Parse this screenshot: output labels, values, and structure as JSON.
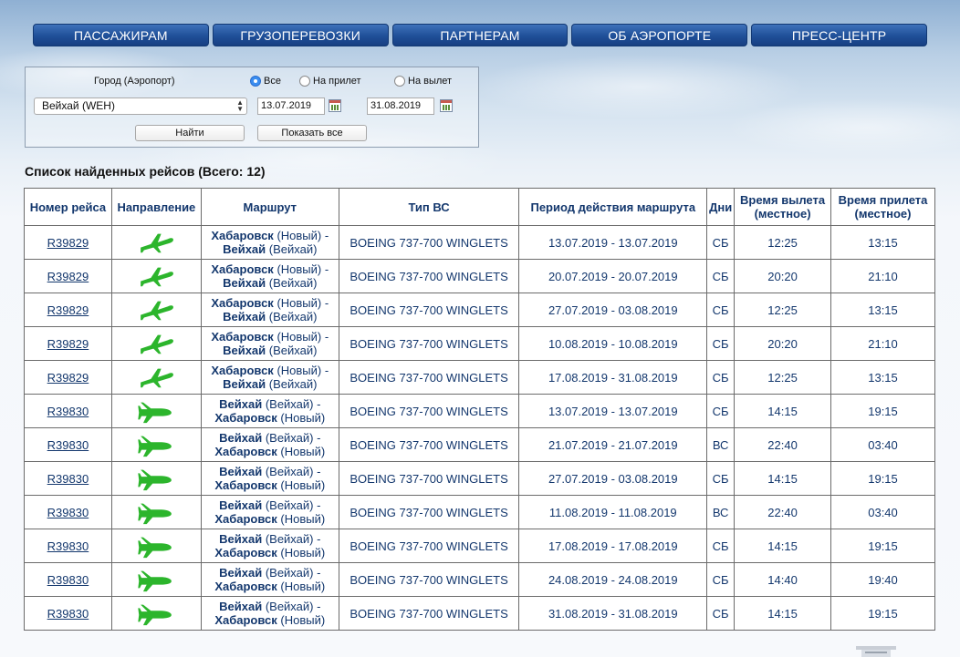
{
  "nav": [
    "ПАССАЖИРАМ",
    "ГРУЗОПЕРЕВОЗКИ",
    "ПАРТНЕРАМ",
    "ОБ АЭРОПОРТЕ",
    "ПРЕСС-ЦЕНТР"
  ],
  "search": {
    "city_label": "Город (Аэропорт)",
    "radio_all": "Все",
    "radio_arrival": "На прилет",
    "radio_departure": "На вылет",
    "selected_radio": "Все",
    "city_value": "Вейхай (WEH)",
    "date_from": "13.07.2019",
    "date_to": "31.08.2019",
    "find_button": "Найти",
    "show_all_button": "Показать все"
  },
  "results_title": "Список найденных рейсов (Всего: 12)",
  "table": {
    "headers": [
      "Номер рейса",
      "Направление",
      "Маршрут",
      "Тип ВС",
      "Период действия маршрута",
      "Дни",
      "Время вылета (местное)",
      "Время прилета (местное)"
    ],
    "rows": [
      {
        "flight": "R39829",
        "direction": "departure-plane-icon",
        "from_city": "Хабаровск",
        "from_airport": "(Новый) -",
        "to_city": "Вейхай",
        "to_airport": "(Вейхай)",
        "aircraft": "BOEING 737-700 WINGLETS",
        "period": "13.07.2019 - 13.07.2019",
        "days": "СБ",
        "dep": "12:25",
        "arr": "13:15"
      },
      {
        "flight": "R39829",
        "direction": "departure-plane-icon",
        "from_city": "Хабаровск",
        "from_airport": "(Новый) -",
        "to_city": "Вейхай",
        "to_airport": "(Вейхай)",
        "aircraft": "BOEING 737-700 WINGLETS",
        "period": "20.07.2019 - 20.07.2019",
        "days": "СБ",
        "dep": "20:20",
        "arr": "21:10"
      },
      {
        "flight": "R39829",
        "direction": "departure-plane-icon",
        "from_city": "Хабаровск",
        "from_airport": "(Новый) -",
        "to_city": "Вейхай",
        "to_airport": "(Вейхай)",
        "aircraft": "BOEING 737-700 WINGLETS",
        "period": "27.07.2019 - 03.08.2019",
        "days": "СБ",
        "dep": "12:25",
        "arr": "13:15"
      },
      {
        "flight": "R39829",
        "direction": "departure-plane-icon",
        "from_city": "Хабаровск",
        "from_airport": "(Новый) -",
        "to_city": "Вейхай",
        "to_airport": "(Вейхай)",
        "aircraft": "BOEING 737-700 WINGLETS",
        "period": "10.08.2019 - 10.08.2019",
        "days": "СБ",
        "dep": "20:20",
        "arr": "21:10"
      },
      {
        "flight": "R39829",
        "direction": "departure-plane-icon",
        "from_city": "Хабаровск",
        "from_airport": "(Новый) -",
        "to_city": "Вейхай",
        "to_airport": "(Вейхай)",
        "aircraft": "BOEING 737-700 WINGLETS",
        "period": "17.08.2019 - 31.08.2019",
        "days": "СБ",
        "dep": "12:25",
        "arr": "13:15"
      },
      {
        "flight": "R39830",
        "direction": "arrival-plane-icon",
        "from_city": "Вейхай",
        "from_airport": "(Вейхай) -",
        "to_city": "Хабаровск",
        "to_airport": "(Новый)",
        "aircraft": "BOEING 737-700 WINGLETS",
        "period": "13.07.2019 - 13.07.2019",
        "days": "СБ",
        "dep": "14:15",
        "arr": "19:15"
      },
      {
        "flight": "R39830",
        "direction": "arrival-plane-icon",
        "from_city": "Вейхай",
        "from_airport": "(Вейхай) -",
        "to_city": "Хабаровск",
        "to_airport": "(Новый)",
        "aircraft": "BOEING 737-700 WINGLETS",
        "period": "21.07.2019 - 21.07.2019",
        "days": "ВС",
        "dep": "22:40",
        "arr": "03:40"
      },
      {
        "flight": "R39830",
        "direction": "arrival-plane-icon",
        "from_city": "Вейхай",
        "from_airport": "(Вейхай) -",
        "to_city": "Хабаровск",
        "to_airport": "(Новый)",
        "aircraft": "BOEING 737-700 WINGLETS",
        "period": "27.07.2019 - 03.08.2019",
        "days": "СБ",
        "dep": "14:15",
        "arr": "19:15"
      },
      {
        "flight": "R39830",
        "direction": "arrival-plane-icon",
        "from_city": "Вейхай",
        "from_airport": "(Вейхай) -",
        "to_city": "Хабаровск",
        "to_airport": "(Новый)",
        "aircraft": "BOEING 737-700 WINGLETS",
        "period": "11.08.2019 - 11.08.2019",
        "days": "ВС",
        "dep": "22:40",
        "arr": "03:40"
      },
      {
        "flight": "R39830",
        "direction": "arrival-plane-icon",
        "from_city": "Вейхай",
        "from_airport": "(Вейхай) -",
        "to_city": "Хабаровск",
        "to_airport": "(Новый)",
        "aircraft": "BOEING 737-700 WINGLETS",
        "period": "17.08.2019 - 17.08.2019",
        "days": "СБ",
        "dep": "14:15",
        "arr": "19:15"
      },
      {
        "flight": "R39830",
        "direction": "arrival-plane-icon",
        "from_city": "Вейхай",
        "from_airport": "(Вейхай) -",
        "to_city": "Хабаровск",
        "to_airport": "(Новый)",
        "aircraft": "BOEING 737-700 WINGLETS",
        "period": "24.08.2019 - 24.08.2019",
        "days": "СБ",
        "dep": "14:40",
        "arr": "19:40"
      },
      {
        "flight": "R39830",
        "direction": "arrival-plane-icon",
        "from_city": "Вейхай",
        "from_airport": "(Вейхай) -",
        "to_city": "Хабаровск",
        "to_airport": "(Новый)",
        "aircraft": "BOEING 737-700 WINGLETS",
        "period": "31.08.2019 - 31.08.2019",
        "days": "СБ",
        "dep": "14:15",
        "arr": "19:15"
      }
    ]
  },
  "colors": {
    "nav_background": "#1f4f98",
    "text": "#13376d",
    "plane_icon": "#2cb52c"
  }
}
